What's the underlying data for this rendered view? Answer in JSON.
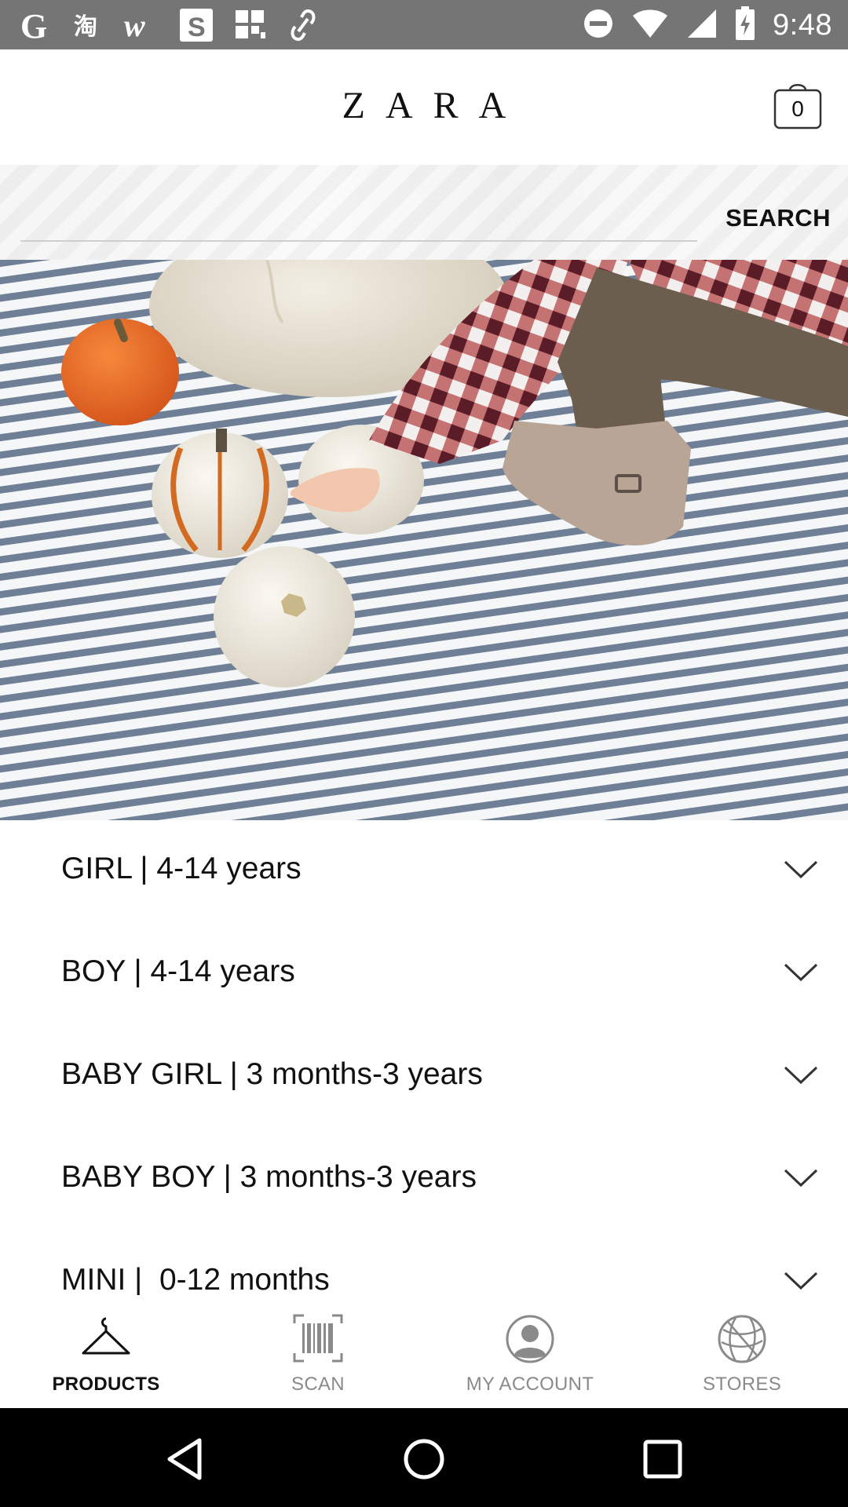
{
  "status_bar": {
    "time": "9:48",
    "left_icons": [
      "google-icon",
      "taobao-icon",
      "w-app-icon",
      "s-app-icon",
      "grid-app-icon",
      "link-icon"
    ],
    "right_icons": [
      "do-not-disturb-icon",
      "wifi-icon",
      "signal-icon",
      "battery-charging-icon"
    ]
  },
  "header": {
    "logo": "ZARA",
    "cart_count": "0"
  },
  "search": {
    "placeholder": "",
    "button_label": "SEARCH"
  },
  "categories": [
    {
      "label": "GIRL | 4-14 years"
    },
    {
      "label": "BOY | 4-14 years"
    },
    {
      "label": "BABY GIRL | 3 months-3 years"
    },
    {
      "label": "BABY BOY | 3 months-3 years"
    },
    {
      "label": "MINI |  0-12 months"
    }
  ],
  "bottom_nav": {
    "items": [
      {
        "label": "PRODUCTS",
        "icon": "hanger-icon",
        "active": true
      },
      {
        "label": "SCAN",
        "icon": "barcode-icon",
        "active": false
      },
      {
        "label": "MY ACCOUNT",
        "icon": "account-icon",
        "active": false
      },
      {
        "label": "STORES",
        "icon": "globe-icon",
        "active": false
      }
    ]
  },
  "colors": {
    "status_bar": "#757575",
    "text": "#111111",
    "inactive": "#8a8a8a",
    "system_nav": "#000000"
  }
}
